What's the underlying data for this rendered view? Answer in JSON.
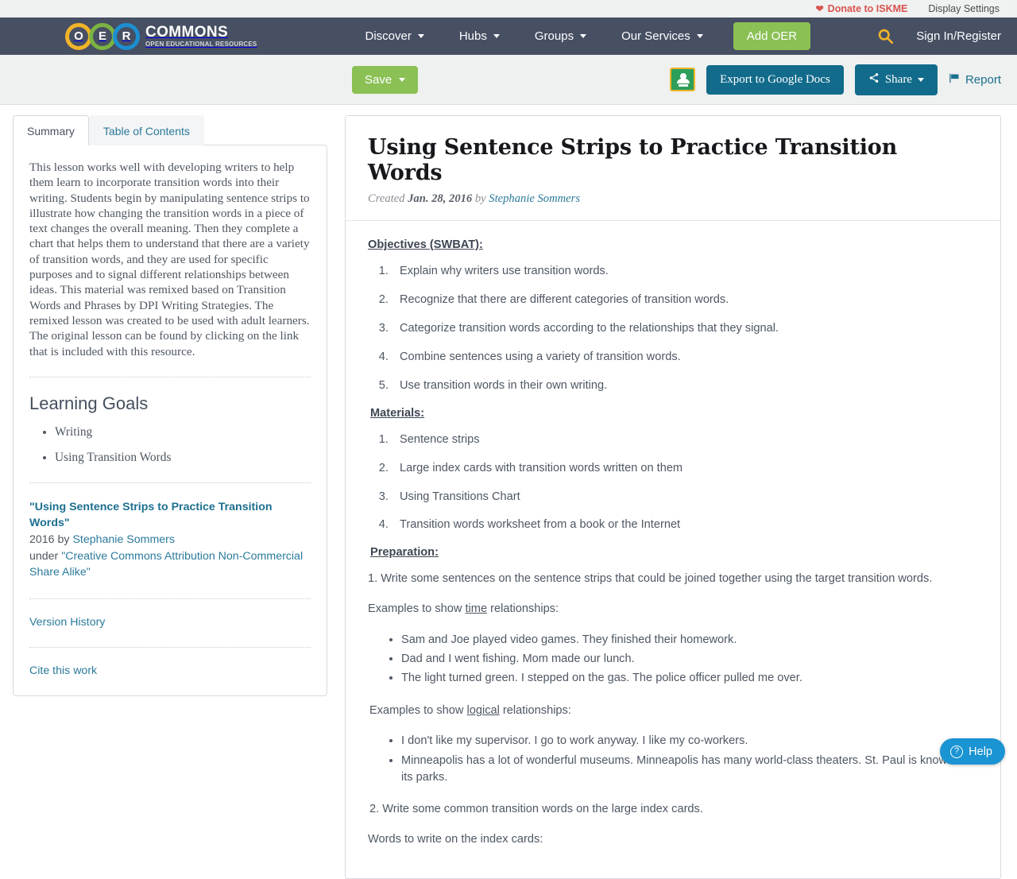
{
  "utility_bar": {
    "donate_label": "Donate to ISKME",
    "donate_icon": "heart-icon",
    "display_settings_label": "Display Settings"
  },
  "nav": {
    "logo": {
      "ring_letters": [
        "O",
        "E",
        "R"
      ],
      "title": "COMMONS",
      "subtitle": "OPEN EDUCATIONAL RESOURCES",
      "ring_colors": [
        "#f0b429",
        "#7cb342",
        "#1c8fd1"
      ]
    },
    "items": [
      {
        "label": "Discover",
        "has_caret": true
      },
      {
        "label": "Hubs",
        "has_caret": true
      },
      {
        "label": "Groups",
        "has_caret": true
      },
      {
        "label": "Our Services",
        "has_caret": true
      }
    ],
    "add_oer_label": "Add OER",
    "search_icon": "search-icon",
    "signin_label": "Sign In/Register",
    "bar_color": "#474f63",
    "accent_green": "#8ac054",
    "search_icon_color": "#f0b429"
  },
  "toolbar": {
    "save_label": "Save",
    "google_classroom_icon": "google-classroom-icon",
    "export_label": "Export to Google Docs",
    "share_label": "Share",
    "report_label": "Report",
    "teal": "#126b8b"
  },
  "sidebar": {
    "tabs": [
      {
        "label": "Summary",
        "active": true
      },
      {
        "label": "Table of Contents",
        "active": false
      }
    ],
    "summary": "This lesson works well with developing writers to help them learn to incorporate transition words into their writing. Students begin by manipulating sentence strips to illustrate how changing the transition words in a piece of text changes the overall meaning. Then they complete a chart that helps them to understand that there are a variety of transition words, and they are used for specific purposes and to signal different relationships between ideas. This material was remixed based on Transition Words and Phrases by DPI Writing Strategies. The remixed lesson was created to be used with adult learners. The original lesson can be found by clicking on the link that is included with this resource.",
    "learning_goals_heading": "Learning Goals",
    "learning_goals": [
      "Writing",
      "Using Transition Words"
    ],
    "attribution": {
      "work_title": "\"Using Sentence Strips to Practice Transition Words\"",
      "year_by": "2016 by ",
      "author": "Stephanie Sommers",
      "under_label": "under ",
      "license": "\"Creative Commons Attribution Non-Commercial Share Alike\""
    },
    "version_history_label": "Version History",
    "cite_label": "Cite this work"
  },
  "document": {
    "title": "Using Sentence Strips to Practice Transition Words",
    "created_label": "Created ",
    "created_date": "Jan. 28, 2016",
    "by_label": " by ",
    "author": "Stephanie Sommers",
    "objectives_heading": "Objectives (SWBAT):",
    "objectives": [
      "Explain why writers use transition words.",
      "Recognize that there are different categories of transition words.",
      "Categorize transition words according to the relationships that they signal.",
      "Combine sentences using a variety of transition words.",
      "Use transition words in their own writing."
    ],
    "materials_heading": "Materials:",
    "materials": [
      "Sentence strips",
      "Large index cards with transition words written on them",
      "Using Transitions Chart",
      "Transition words worksheet from a book or the Internet"
    ],
    "preparation_heading": "Preparation:",
    "prep_step_1": "1. Write some sentences on the sentence strips that could be joined together using the target transition words.",
    "time_examples_intro_a": "Examples to show ",
    "time_examples_intro_b": "time",
    "time_examples_intro_c": " relationships:",
    "time_examples": [
      "Sam and Joe played video games.          They finished their homework.",
      "Dad and I went fishing.                Mom made our lunch.",
      "The light turned green.      I stepped on the gas.                 The police officer pulled me over."
    ],
    "logical_examples_intro_a": "Examples to show ",
    "logical_examples_intro_b": "logical",
    "logical_examples_intro_c": " relationships:",
    "logical_examples": [
      "I don't like my supervisor.           I go to work anyway.                  I like my co-workers.",
      "Minneapolis has a lot of wonderful museums.           Minneapolis has many world-class theaters.  St. Paul is known for its parks."
    ],
    "prep_step_2": "2. Write some common transition words on the large index cards.",
    "words_intro": "Words to write on the index cards:"
  },
  "help_widget": {
    "label": "Help",
    "icon": "question-circle-icon",
    "color": "#1a94d2"
  }
}
